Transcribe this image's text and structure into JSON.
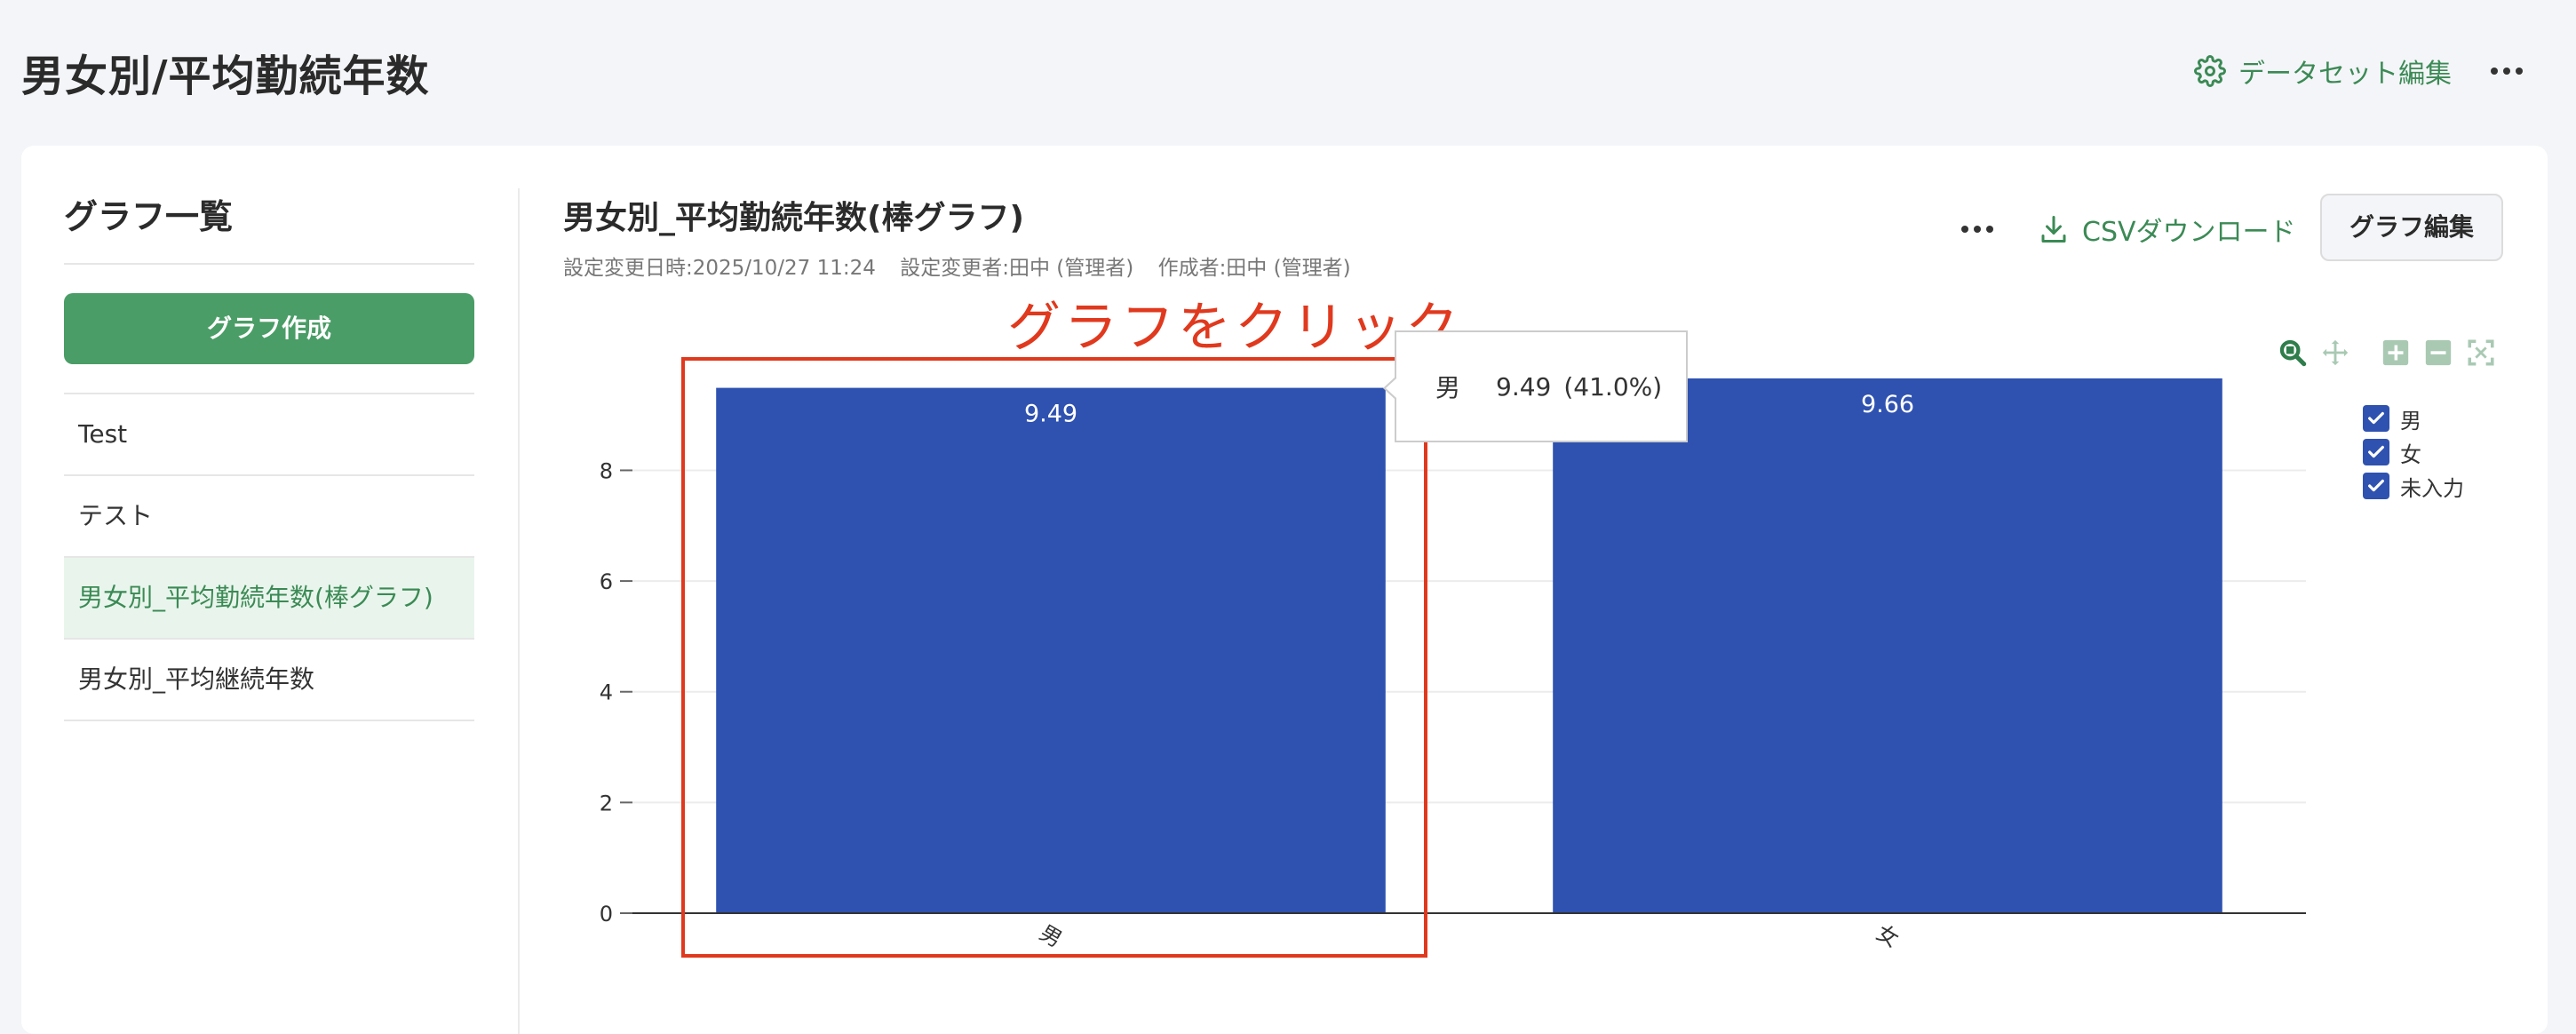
{
  "header": {
    "title": "男女別/平均勤続年数",
    "dataset_edit_label": "データセット編集"
  },
  "sidebar": {
    "title": "グラフ一覧",
    "create_button_label": "グラフ作成",
    "items": [
      {
        "label": "Test",
        "active": false
      },
      {
        "label": "テスト",
        "active": false
      },
      {
        "label": "男女別_平均勤続年数(棒グラフ)",
        "active": true
      },
      {
        "label": "男女別_平均継続年数",
        "active": false
      }
    ]
  },
  "main": {
    "graph_title": "男女別_平均勤続年数(棒グラフ)",
    "meta": {
      "updated_at": "設定変更日時:2025/10/27 11:24",
      "updated_by": "設定変更者:田中 (管理者)",
      "created_by": "作成者:田中 (管理者)"
    },
    "csv_download_label": "CSVダウンロード",
    "graph_edit_label": "グラフ編集"
  },
  "annotation": {
    "label": "グラフをクリック",
    "color": "#e0391e"
  },
  "tooltip": {
    "category": "男",
    "value": "9.49",
    "percent": "(41.0%)"
  },
  "legend": [
    {
      "label": "男",
      "checked": true
    },
    {
      "label": "女",
      "checked": true
    },
    {
      "label": "未入力",
      "checked": true
    }
  ],
  "colors": {
    "accent": "#3b8a55",
    "primary_button": "#4a9d66",
    "bar": "#2f52b0"
  },
  "chart_data": {
    "type": "bar",
    "categories": [
      "男",
      "女"
    ],
    "values": [
      9.49,
      9.66
    ],
    "data_labels": [
      "9.49",
      "9.66"
    ],
    "ylim": [
      0,
      9.66
    ],
    "yticks": [
      0,
      2,
      4,
      6,
      8
    ],
    "grid": true,
    "legend_placement": "right",
    "title": "",
    "xlabel": "",
    "ylabel": ""
  }
}
